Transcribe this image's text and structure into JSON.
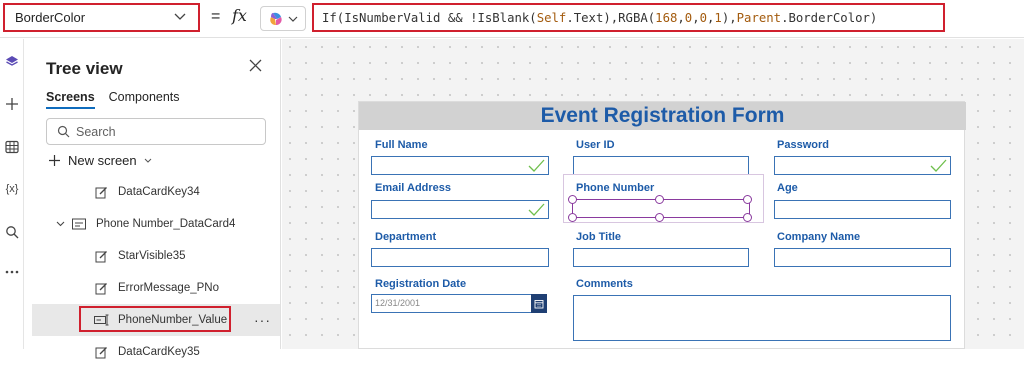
{
  "formula_bar": {
    "property": "BorderColor",
    "equals": "=",
    "fx": "fx",
    "formula_tokens": [
      {
        "t": "If(IsNumberValid && !IsBlank(",
        "c": "tk-fn"
      },
      {
        "t": "Self",
        "c": "tk-kw"
      },
      {
        "t": ".Text),RGBA(",
        "c": "tk-fn"
      },
      {
        "t": "168",
        "c": "tk-num"
      },
      {
        "t": ",",
        "c": "tk-fn"
      },
      {
        "t": "0",
        "c": "tk-num"
      },
      {
        "t": ",",
        "c": "tk-fn"
      },
      {
        "t": "0",
        "c": "tk-num"
      },
      {
        "t": ",",
        "c": "tk-fn"
      },
      {
        "t": "1",
        "c": "tk-num"
      },
      {
        "t": "),",
        "c": "tk-fn"
      },
      {
        "t": "Parent",
        "c": "tk-kw"
      },
      {
        "t": " .BorderColor)",
        "c": "tk-fn"
      }
    ]
  },
  "rail": {
    "icons": [
      "layers-icon",
      "plus-icon",
      "table-icon",
      "variables-icon",
      "search-icon",
      "more-icon"
    ],
    "variables_label": "{x}"
  },
  "tree": {
    "title": "Tree view",
    "tabs": [
      {
        "label": "Screens",
        "active": true
      },
      {
        "label": "Components",
        "active": false
      }
    ],
    "search_placeholder": "Search",
    "new_screen_label": "New screen",
    "items": [
      {
        "label": "DataCardKey34",
        "icon": "edit-icon"
      },
      {
        "label": "Phone Number_DataCard4",
        "icon": "card-icon",
        "expanded": true
      },
      {
        "label": "StarVisible35",
        "icon": "edit-icon"
      },
      {
        "label": "ErrorMessage_PNo",
        "icon": "edit-icon"
      },
      {
        "label": "PhoneNumber_Value",
        "icon": "text-input-icon",
        "selected": true
      },
      {
        "label": "DataCardKey35",
        "icon": "edit-icon"
      }
    ],
    "more": "···"
  },
  "form": {
    "title": "Event Registration Form",
    "fields": {
      "full_name": "Full Name",
      "user_id": "User ID",
      "password": "Password",
      "email": "Email Address",
      "phone": "Phone Number",
      "age": "Age",
      "department": "Department",
      "job_title": "Job Title",
      "company": "Company Name",
      "reg_date": "Registration Date",
      "comments": "Comments"
    },
    "date_value": "12/31/2001"
  },
  "colors": {
    "highlight_red": "#d0202e",
    "form_title_blue": "#1d5ba8",
    "check_green": "#6fbf4c",
    "selection_purple": "#8a3a9e"
  }
}
